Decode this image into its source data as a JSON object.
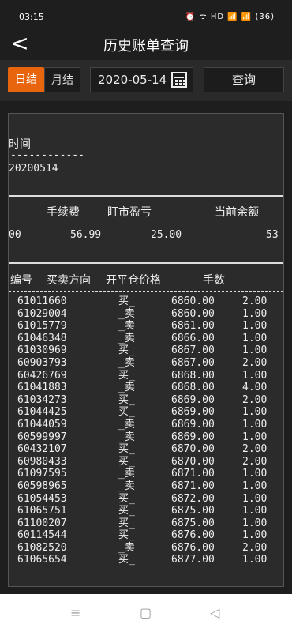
{
  "status_bar": {
    "time": "03:15",
    "icons": "⏰ ᯤ HD 📶 📶 (36)"
  },
  "nav": {
    "back": "<",
    "title": "历史账单查询"
  },
  "filters": {
    "day_label": "日结",
    "month_label": "月结",
    "date": "2020-05-14",
    "query_label": "查询"
  },
  "summary": {
    "time_label": "时间",
    "date_line": "------------",
    "date_value": "20200514",
    "col_fee": "手续费",
    "col_mtm": "盯市盈亏",
    "col_balance": "当前余额",
    "val_prefix": "00",
    "val_fee": "56.99",
    "val_mtm": "25.00",
    "val_balance": "53"
  },
  "trades": {
    "header": {
      "id": "编号",
      "side": "买卖方向",
      "price": "开平仓价格",
      "qty": "手数"
    },
    "rows": [
      {
        "id": "61011660",
        "side": "买_",
        "price": "6860.00",
        "qty": "2.00"
      },
      {
        "id": "61029004",
        "side": "_卖",
        "price": "6860.00",
        "qty": "1.00"
      },
      {
        "id": "61015779",
        "side": "_卖",
        "price": "6861.00",
        "qty": "1.00"
      },
      {
        "id": "61046348",
        "side": "_卖",
        "price": "6866.00",
        "qty": "1.00"
      },
      {
        "id": "61030969",
        "side": "买_",
        "price": "6867.00",
        "qty": "1.00"
      },
      {
        "id": "60903793",
        "side": "_卖",
        "price": "6867.00",
        "qty": "2.00"
      },
      {
        "id": "60426769",
        "side": "买_",
        "price": "6868.00",
        "qty": "1.00"
      },
      {
        "id": "61041883",
        "side": "_卖",
        "price": "6868.00",
        "qty": "4.00"
      },
      {
        "id": "61034273",
        "side": "买_",
        "price": "6869.00",
        "qty": "2.00"
      },
      {
        "id": "61044425",
        "side": "买_",
        "price": "6869.00",
        "qty": "1.00"
      },
      {
        "id": "61044059",
        "side": "_卖",
        "price": "6869.00",
        "qty": "1.00"
      },
      {
        "id": "60599997",
        "side": "_卖",
        "price": "6869.00",
        "qty": "1.00"
      },
      {
        "id": "60432107",
        "side": "买_",
        "price": "6870.00",
        "qty": "2.00"
      },
      {
        "id": "60980433",
        "side": "买_",
        "price": "6870.00",
        "qty": "2.00"
      },
      {
        "id": "61097595",
        "side": "_卖",
        "price": "6871.00",
        "qty": "1.00"
      },
      {
        "id": "60598965",
        "side": "_卖",
        "price": "6871.00",
        "qty": "1.00"
      },
      {
        "id": "61054453",
        "side": "买_",
        "price": "6872.00",
        "qty": "1.00"
      },
      {
        "id": "61065751",
        "side": "买_",
        "price": "6875.00",
        "qty": "1.00"
      },
      {
        "id": "61100207",
        "side": "买_",
        "price": "6875.00",
        "qty": "1.00"
      },
      {
        "id": "60114544",
        "side": "买_",
        "price": "6876.00",
        "qty": "1.00"
      },
      {
        "id": "61082520",
        "side": "_卖",
        "price": "6876.00",
        "qty": "2.00"
      },
      {
        "id": "61065654",
        "side": "买_",
        "price": "6877.00",
        "qty": "1.00"
      }
    ]
  },
  "bottom_nav": {
    "menu": "≡",
    "home": "▢",
    "back": "◁"
  }
}
